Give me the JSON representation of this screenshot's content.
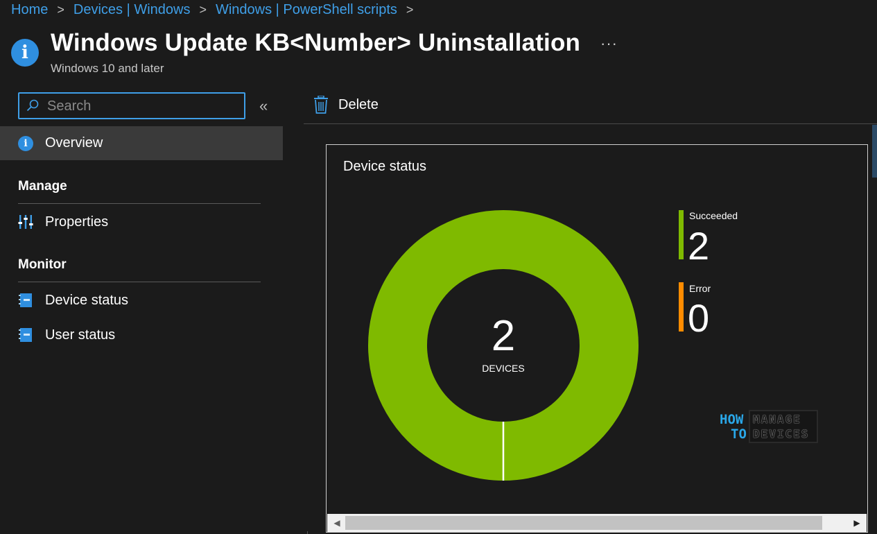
{
  "breadcrumb": {
    "items": [
      "Home",
      "Devices | Windows",
      "Windows | PowerShell scripts"
    ],
    "separator": ">"
  },
  "header": {
    "icon": "info-icon",
    "title": "Windows Update KB<Number> Uninstallation",
    "subtitle": "Windows 10 and later",
    "more": "···"
  },
  "sidebar": {
    "search": {
      "placeholder": "Search",
      "value": ""
    },
    "collapse": "«",
    "overview": {
      "label": "Overview",
      "icon": "info-icon"
    },
    "sections": [
      {
        "header": "Manage",
        "items": [
          {
            "label": "Properties",
            "icon": "properties-icon"
          }
        ]
      },
      {
        "header": "Monitor",
        "items": [
          {
            "label": "Device status",
            "icon": "report-icon"
          },
          {
            "label": "User status",
            "icon": "report-icon"
          }
        ]
      }
    ]
  },
  "toolbar": {
    "delete_label": "Delete",
    "delete_icon": "trash-icon"
  },
  "card": {
    "title": "Device status",
    "center_value": "2",
    "center_label": "DEVICES",
    "legend": [
      {
        "label": "Succeeded",
        "value": "2",
        "color": "#7fba00"
      },
      {
        "label": "Error",
        "value": "0",
        "color": "#ff8c00"
      }
    ],
    "watermark": {
      "line1": "HOW",
      "line2": "TO",
      "text1": "MANAGE",
      "text2": "DEVICES"
    }
  },
  "chart_data": {
    "type": "pie",
    "title": "Device status",
    "categories": [
      "Succeeded",
      "Error"
    ],
    "values": [
      2,
      0
    ],
    "colors": [
      "#7fba00",
      "#ff8c00"
    ],
    "donut": true,
    "center_text": "2 DEVICES",
    "legend_position": "right"
  }
}
